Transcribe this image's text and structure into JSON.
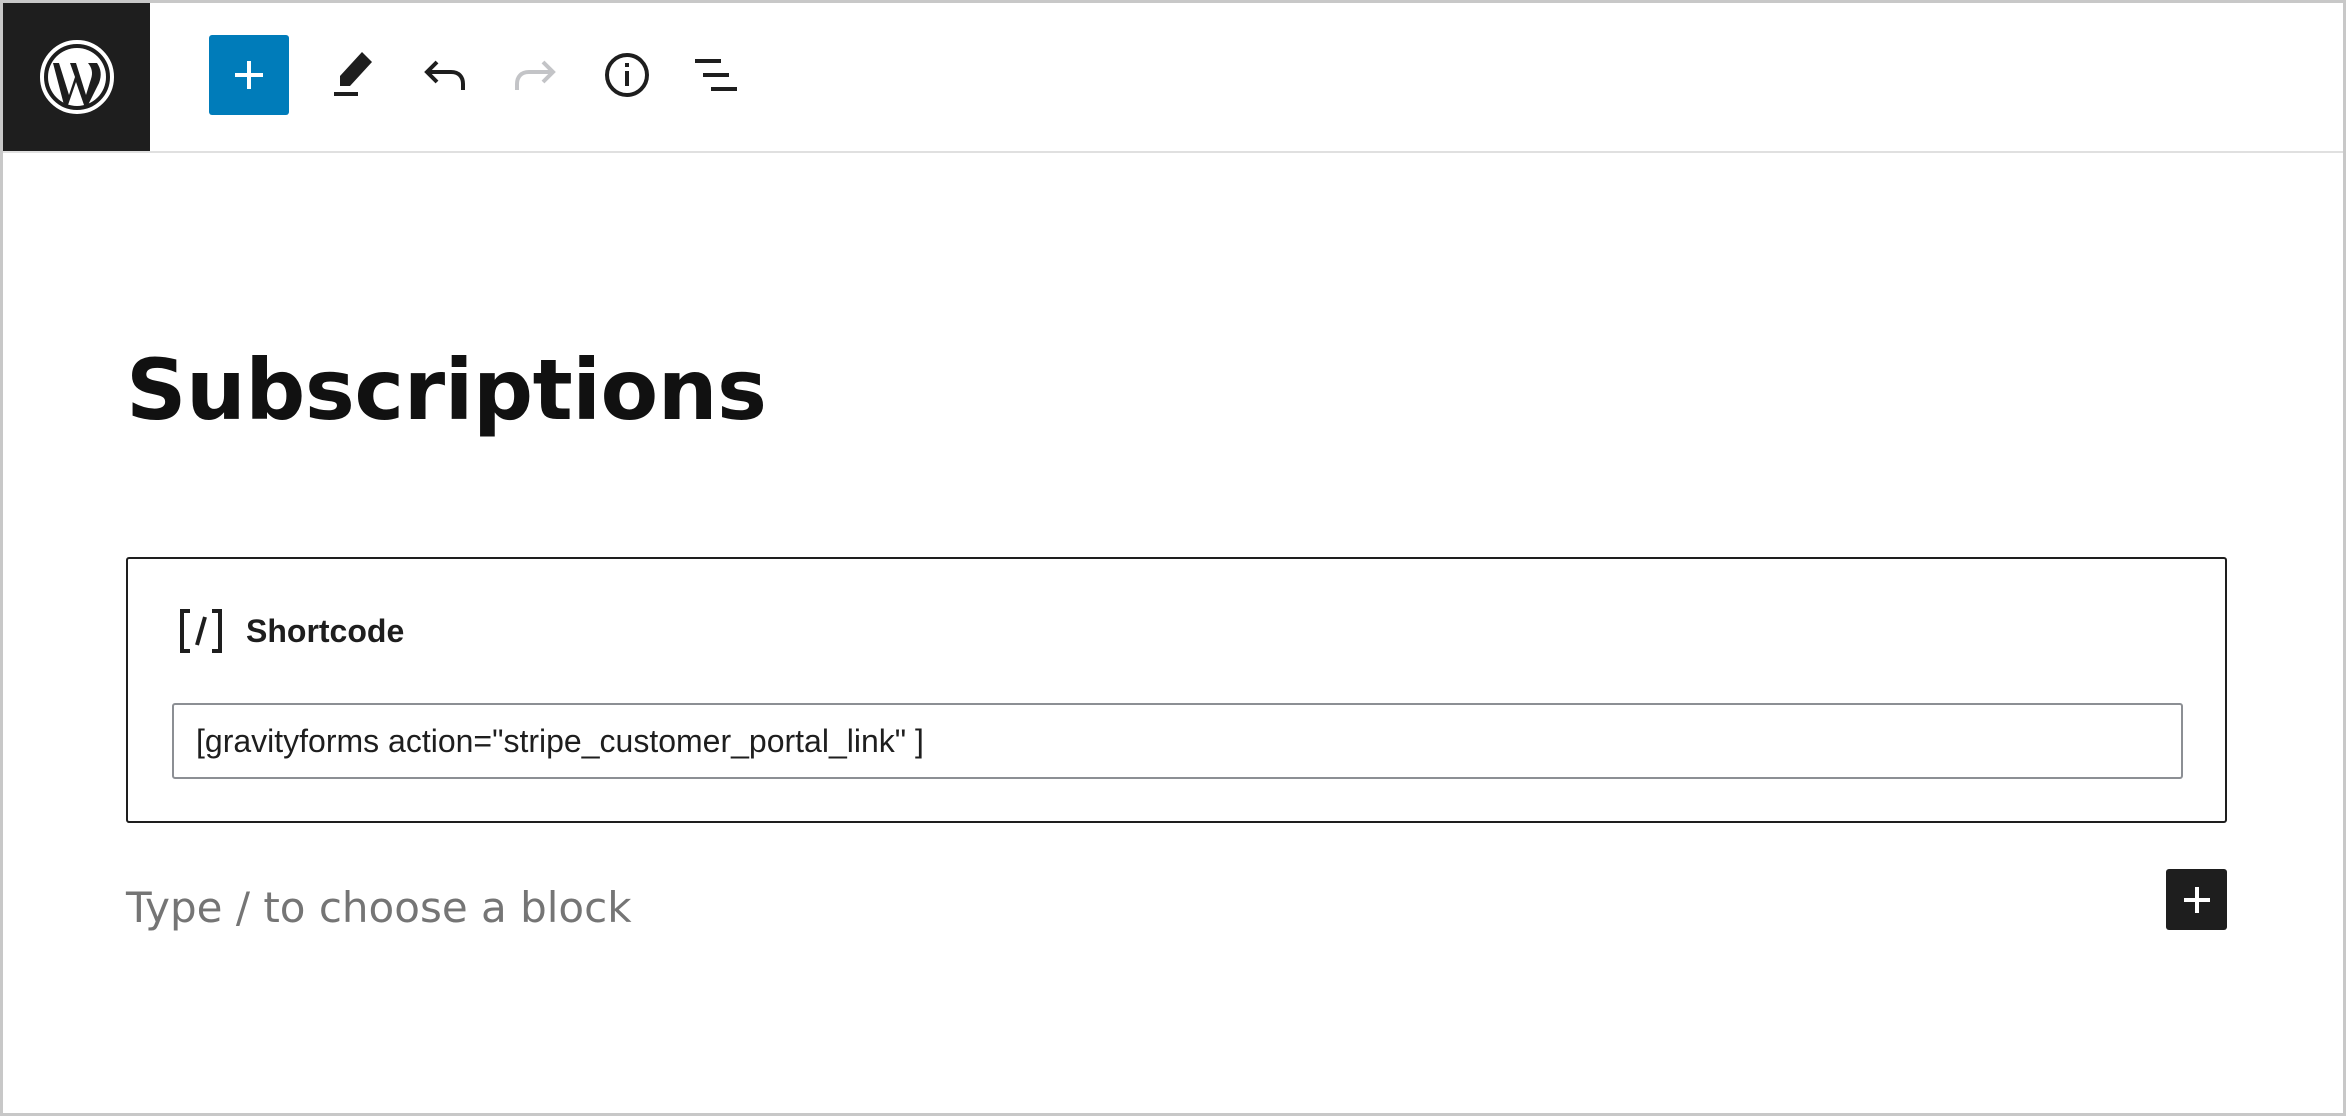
{
  "toolbar": {
    "logo_icon": "wordpress-logo-icon",
    "add_block_icon": "plus-icon",
    "tools_icon": "pencil-icon",
    "undo_icon": "undo-icon",
    "redo_icon": "redo-icon",
    "details_icon": "info-icon",
    "list_view_icon": "list-view-icon"
  },
  "colors": {
    "accent": "#007cba",
    "dark": "#1e1e1e",
    "placeholder": "#757575",
    "redo_disabled": "#c3c4c7"
  },
  "editor": {
    "title": "Subscriptions",
    "shortcode_block": {
      "icon": "shortcode-icon",
      "label": "Shortcode",
      "value": "[gravityforms action=\"stripe_customer_portal_link\" ]"
    },
    "empty_paragraph_placeholder": "Type / to choose a block",
    "inline_add_icon": "plus-icon"
  }
}
